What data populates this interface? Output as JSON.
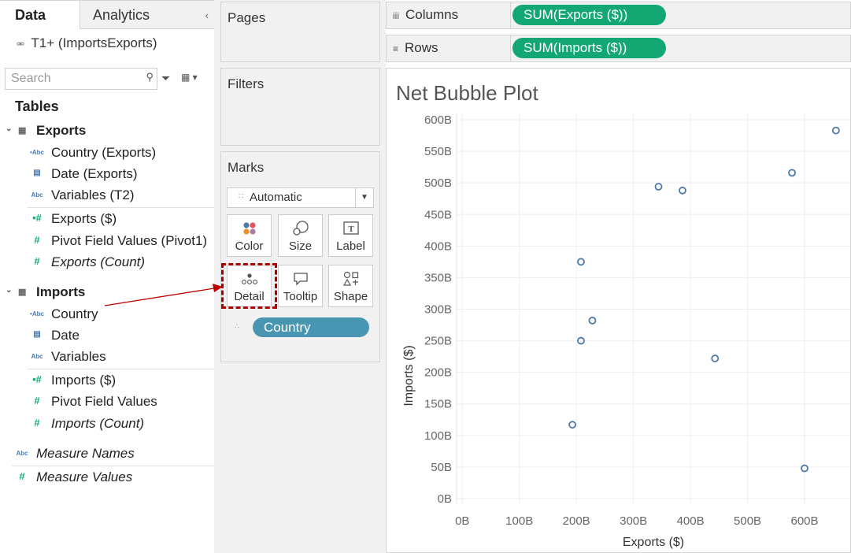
{
  "data_pane": {
    "tabs": {
      "data": "Data",
      "analytics": "Analytics"
    },
    "collapse_icon": "chevron-left-icon",
    "datasource": "T1+ (ImportsExports)",
    "search_placeholder": "Search",
    "tables_heading": "Tables",
    "exports_table": {
      "name": "Exports",
      "dimensions": [
        "Country (Exports)",
        "Date (Exports)",
        "Variables (T2)"
      ],
      "measures": [
        "Exports ($)",
        "Pivot Field Values (Pivot1)",
        "Exports (Count)"
      ]
    },
    "imports_table": {
      "name": "Imports",
      "dimensions": [
        "Country",
        "Date",
        "Variables"
      ],
      "measures": [
        "Imports ($)",
        "Pivot Field Values",
        "Imports (Count)"
      ]
    },
    "measure_names": "Measure Names",
    "measure_values": "Measure Values"
  },
  "cards": {
    "pages": "Pages",
    "filters": "Filters",
    "marks": {
      "title": "Marks",
      "type": "Automatic",
      "buttons": [
        "Color",
        "Size",
        "Label",
        "Detail",
        "Tooltip",
        "Shape"
      ],
      "detail_pill": "Country"
    }
  },
  "shelves": {
    "columns_label": "Columns",
    "columns_pill": "SUM(Exports ($))",
    "rows_label": "Rows",
    "rows_pill": "SUM(Imports ($))"
  },
  "colors": {
    "green_pill": "#13a774",
    "blue_pill": "#4996b2",
    "highlight": "#aa0000",
    "mark": "#4e79a7"
  },
  "chart_data": {
    "type": "scatter",
    "title": "Net Bubble Plot",
    "xlabel": "Exports ($)",
    "ylabel": "Imports ($)",
    "xlim": [
      -10,
      680
    ],
    "ylim": [
      -10,
      610
    ],
    "x_ticks": [
      0,
      100,
      200,
      300,
      400,
      500,
      600
    ],
    "x_tick_labels": [
      "0B",
      "100B",
      "200B",
      "300B",
      "400B",
      "500B",
      "600B"
    ],
    "y_ticks": [
      0,
      50,
      100,
      150,
      200,
      250,
      300,
      350,
      400,
      450,
      500,
      550,
      600
    ],
    "y_tick_labels": [
      "0B",
      "50B",
      "100B",
      "150B",
      "200B",
      "250B",
      "300B",
      "350B",
      "400B",
      "450B",
      "500B",
      "550B",
      "600B"
    ],
    "grid": true,
    "points": [
      {
        "x": 655,
        "y": 583
      },
      {
        "x": 578,
        "y": 516
      },
      {
        "x": 344,
        "y": 494
      },
      {
        "x": 386,
        "y": 488
      },
      {
        "x": 208,
        "y": 375
      },
      {
        "x": 228,
        "y": 282
      },
      {
        "x": 208,
        "y": 250
      },
      {
        "x": 443,
        "y": 222
      },
      {
        "x": 193,
        "y": 117
      },
      {
        "x": 600,
        "y": 48
      }
    ]
  }
}
